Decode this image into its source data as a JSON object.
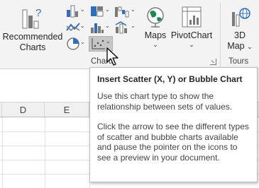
{
  "ribbon": {
    "recommended_charts": {
      "label_line1": "Recommended",
      "label_line2": "Charts"
    },
    "maps": {
      "label": "Maps",
      "dropdown": "⌄"
    },
    "pivotchart": {
      "label": "PivotChart",
      "dropdown": "⌄"
    },
    "map3d": {
      "label_line1": "3D",
      "label_line2": "Map"
    },
    "groups": {
      "charts": "Charts",
      "tours": "Tours"
    }
  },
  "sheet": {
    "columns": [
      "D",
      "E"
    ]
  },
  "tooltip": {
    "title": "Insert Scatter (X, Y) or Bubble Chart",
    "paragraph1": "Use this chart type to show the relationship between sets of values.",
    "paragraph2": "Click the arrow to see the different types of scatter and bubble charts available and pause the pointer on the icons to see a preview in your document."
  },
  "colors": {
    "ribbon_bg": "#f3f3f3",
    "hover_bg": "#c6c6c6",
    "accent_blue": "#2f6fba",
    "accent_green": "#1e8a4c"
  }
}
